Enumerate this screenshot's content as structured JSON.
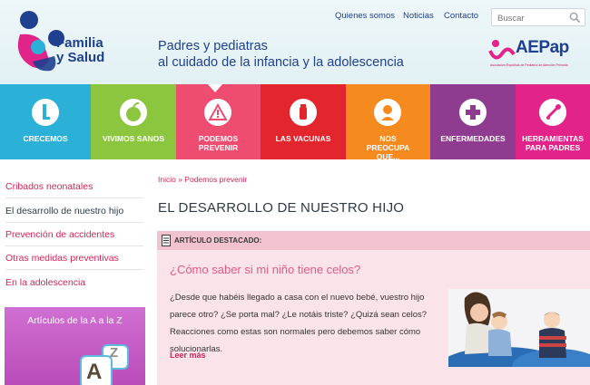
{
  "header": {
    "logo_text_line1": "Familia",
    "logo_text_line2": "y Salud",
    "tagline_line1": "Padres y pediatras",
    "tagline_line2": "al cuidado de la infancia y la adolescencia",
    "links": [
      "Quienes somos",
      "Noticias",
      "Contacto"
    ],
    "search_placeholder": "Buscar",
    "partner_logo_text": "AEPap",
    "partner_logo_subtitle": "Asociación Española de Pediatría de Atención Primaria"
  },
  "nav": {
    "items": [
      {
        "label": "CRECEMOS",
        "color": "#2bb0d8",
        "icon": "growth-chart-icon"
      },
      {
        "label": "VIVIMOS SANOS",
        "color": "#8cc63f",
        "icon": "apple-icon"
      },
      {
        "label": "PODEMOS PREVENIR",
        "color": "#ee4d71",
        "icon": "warning-icon"
      },
      {
        "label": "LAS VACUNAS",
        "color": "#e3262d",
        "icon": "vaccine-vial-icon"
      },
      {
        "label": "NOS PREOCUPA QUE...",
        "color": "#f58a1f",
        "icon": "thinking-person-icon"
      },
      {
        "label": "ENFERMEDADES",
        "color": "#8f3b8f",
        "icon": "medical-cross-icon"
      },
      {
        "label": "HERRAMIENTAS PARA PADRES",
        "color": "#e2248a",
        "icon": "stethoscope-icon"
      }
    ],
    "active_index": 2
  },
  "sidebar": {
    "items": [
      {
        "label": "Cribados neonatales",
        "color": "#d02559"
      },
      {
        "label": "El desarrollo de nuestro hijo",
        "color": "#2f3a45"
      },
      {
        "label": "Prevención de accidentes",
        "color": "#d02559"
      },
      {
        "label": "Otras medidas preventivas",
        "color": "#d02559"
      },
      {
        "label": "En la adolescencia",
        "color": "#d02559"
      }
    ],
    "promo_title": "Artículos de la A a la Z",
    "promo_letters": [
      "A",
      "Z"
    ]
  },
  "main": {
    "breadcrumb": "Inicio » Podemos prevenir",
    "page_title": "EL DESARROLLO DE NUESTRO HIJO",
    "featured_label": "ARTÍCULO DESTACADO:",
    "article_title": "¿Cómo saber si mi niño tiene celos?",
    "article_body": "¿Desde que habéis llegado a casa con el nuevo bebé, vuestro hijo parece otro? ¿Se porta mal? ¿Le notáis triste? ¿Quizá sean celos? Reacciones como estas son normales pero debemos saber cómo solucionarlas.",
    "read_more": "Leer más"
  },
  "colors": {
    "brand_blue": "#1f3f8f",
    "accent_pink": "#d02559",
    "featured_bg": "#fbe3ea"
  }
}
